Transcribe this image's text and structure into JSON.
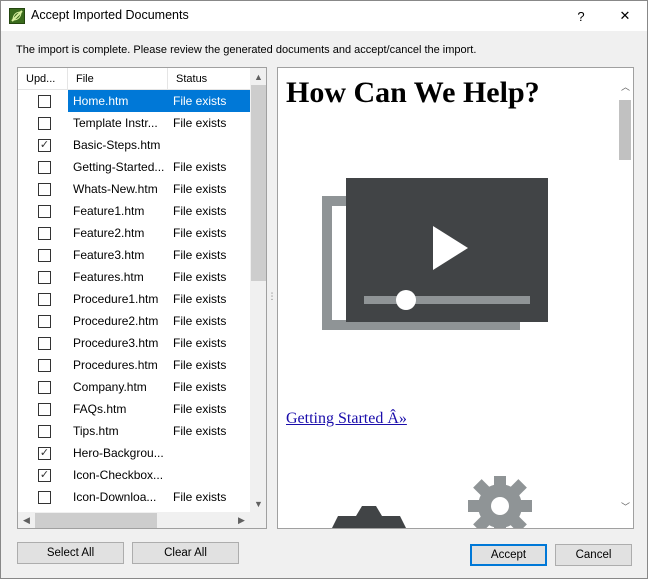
{
  "window": {
    "title": "Accept Imported Documents",
    "help_label": "?",
    "close_label": "✕",
    "app_icon": "document-leaf-icon"
  },
  "instruction": "The import is complete. Please review the generated documents and accept/cancel the import.",
  "list": {
    "columns": [
      "Upd...",
      "File",
      "Status"
    ],
    "rows": [
      {
        "checked": false,
        "file": "Home.htm",
        "status": "File exists",
        "selected": true
      },
      {
        "checked": false,
        "file": "Template Instr...",
        "status": "File exists"
      },
      {
        "checked": true,
        "file": "Basic-Steps.htm",
        "status": ""
      },
      {
        "checked": false,
        "file": "Getting-Started...",
        "status": "File exists"
      },
      {
        "checked": false,
        "file": "Whats-New.htm",
        "status": "File exists"
      },
      {
        "checked": false,
        "file": "Feature1.htm",
        "status": "File exists"
      },
      {
        "checked": false,
        "file": "Feature2.htm",
        "status": "File exists"
      },
      {
        "checked": false,
        "file": "Feature3.htm",
        "status": "File exists"
      },
      {
        "checked": false,
        "file": "Features.htm",
        "status": "File exists"
      },
      {
        "checked": false,
        "file": "Procedure1.htm",
        "status": "File exists"
      },
      {
        "checked": false,
        "file": "Procedure2.htm",
        "status": "File exists"
      },
      {
        "checked": false,
        "file": "Procedure3.htm",
        "status": "File exists"
      },
      {
        "checked": false,
        "file": "Procedures.htm",
        "status": "File exists"
      },
      {
        "checked": false,
        "file": "Company.htm",
        "status": "File exists"
      },
      {
        "checked": false,
        "file": "FAQs.htm",
        "status": "File exists"
      },
      {
        "checked": false,
        "file": "Tips.htm",
        "status": "File exists"
      },
      {
        "checked": true,
        "file": "Hero-Backgrou...",
        "status": ""
      },
      {
        "checked": true,
        "file": "Icon-Checkbox...",
        "status": ""
      },
      {
        "checked": false,
        "file": "Icon-Downloa...",
        "status": "File exists"
      }
    ]
  },
  "preview": {
    "heading": "How Can We Help?",
    "link": "Getting Started Â»",
    "illustration_icon": "video-player-icon",
    "gear_icon": "gear-icon"
  },
  "buttons": {
    "select_all": "Select All",
    "clear_all": "Clear All",
    "accept": "Accept",
    "cancel": "Cancel"
  },
  "colors": {
    "selection": "#0078d7",
    "illustration_dark": "#414446",
    "illustration_light": "#8f9496"
  }
}
